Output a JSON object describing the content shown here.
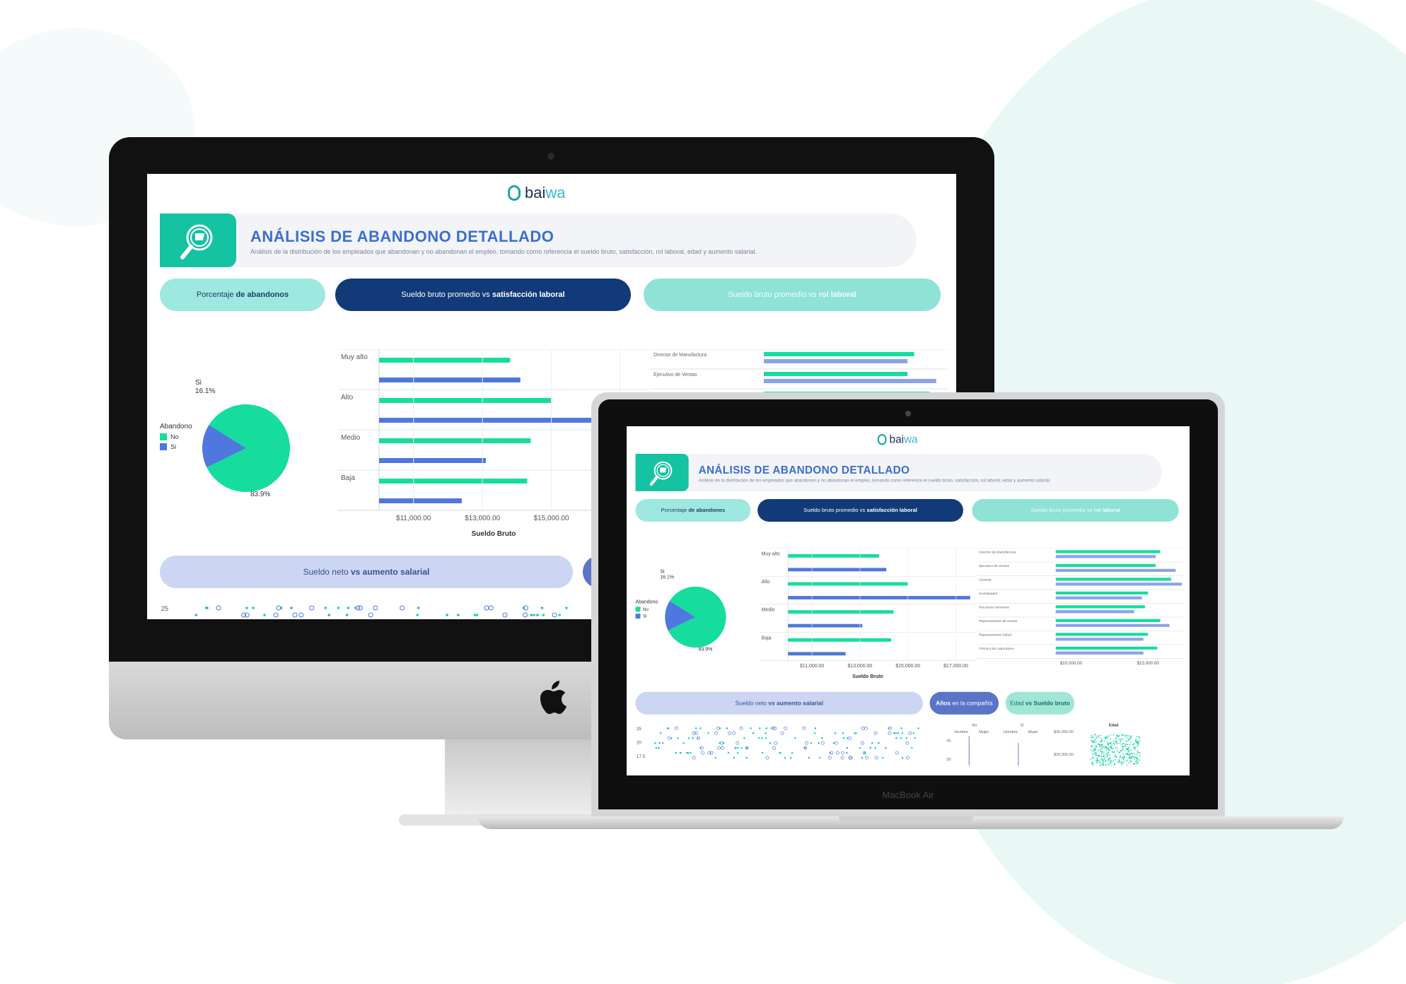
{
  "brand": {
    "logo_a": "bai",
    "logo_b": "wa"
  },
  "header": {
    "title": "ANÁLISIS DE ABANDONO DETALLADO",
    "subtitle": "Análisis de la distribución de los empleados que abandonan y no abandonan el empleo, tomando como referencia el sueldo bruto, satisfacción, rol laboral, edad y aumento salarial."
  },
  "tabs": {
    "t1_a": "Porcentaje ",
    "t1_b": "de abandonos",
    "t2_a": "Sueldo bruto promedio vs ",
    "t2_b": "satisfacción laboral",
    "t3_a": "Sueldo bruto promedio vs ",
    "t3_b": "rol laboral"
  },
  "bottom_tabs": {
    "b1_a": "Sueldo neto ",
    "b1_b": "vs aumento salarial",
    "b2_a": "Años ",
    "b2_b": "en la compañía",
    "b3_a": "Edad ",
    "b3_b": "vs Sueldo bruto"
  },
  "device": {
    "laptop_brand": "MacBook Air"
  },
  "colors": {
    "teal": "#16dd9e",
    "blue": "#4f78de",
    "navy": "#123a78"
  },
  "chart_data": [
    {
      "type": "pie",
      "legend_title": "Abandono",
      "categories": [
        "No",
        "Si"
      ],
      "values": [
        83.9,
        16.1
      ],
      "labels": [
        "83.9%",
        "16.1%"
      ]
    },
    {
      "type": "bar",
      "orientation": "horizontal",
      "categories": [
        "Muy alto",
        "Alto",
        "Medio",
        "Baja"
      ],
      "xlabel": "Sueldo Bruto",
      "ticks": [
        "$11,000.00",
        "$13,000.00",
        "$15,000.00",
        "$17,000.00"
      ],
      "xlim": [
        10000,
        17800
      ],
      "series": [
        {
          "name": "No",
          "values": [
            13800,
            15000,
            14400,
            14300
          ]
        },
        {
          "name": "Si",
          "values": [
            14100,
            17600,
            13100,
            12400
          ]
        }
      ]
    },
    {
      "type": "bar",
      "orientation": "horizontal",
      "categories": [
        "Director de Manufactura",
        "Ejecutivo de Ventas",
        "Gerente",
        "Investigador",
        "Recursos Humanos",
        "Representante de ventas",
        "Representante Salud",
        "Técnico de Laboratorio"
      ],
      "ticks": [
        "$10,000.00",
        "$15,000.00"
      ],
      "xlim": [
        9000,
        17000
      ],
      "series": [
        {
          "name": "No",
          "values": [
            15800,
            15500,
            16500,
            15000,
            14800,
            15800,
            15000,
            15600
          ]
        },
        {
          "name": "Si",
          "values": [
            15500,
            16800,
            17200,
            14600,
            14100,
            16400,
            14700,
            14700
          ]
        }
      ]
    },
    {
      "type": "scatter",
      "ticks": [
        "25",
        "20",
        "17.5"
      ]
    },
    {
      "type": "bar",
      "groups": [
        "No",
        "Si"
      ],
      "categories": [
        "Hombre",
        "Mujer",
        "Hombre",
        "Mujer"
      ],
      "ticks": [
        "40",
        "30"
      ]
    },
    {
      "type": "scatter",
      "title": "Edad",
      "ticks": [
        "$30,000.00",
        "$20,000.00"
      ]
    }
  ]
}
